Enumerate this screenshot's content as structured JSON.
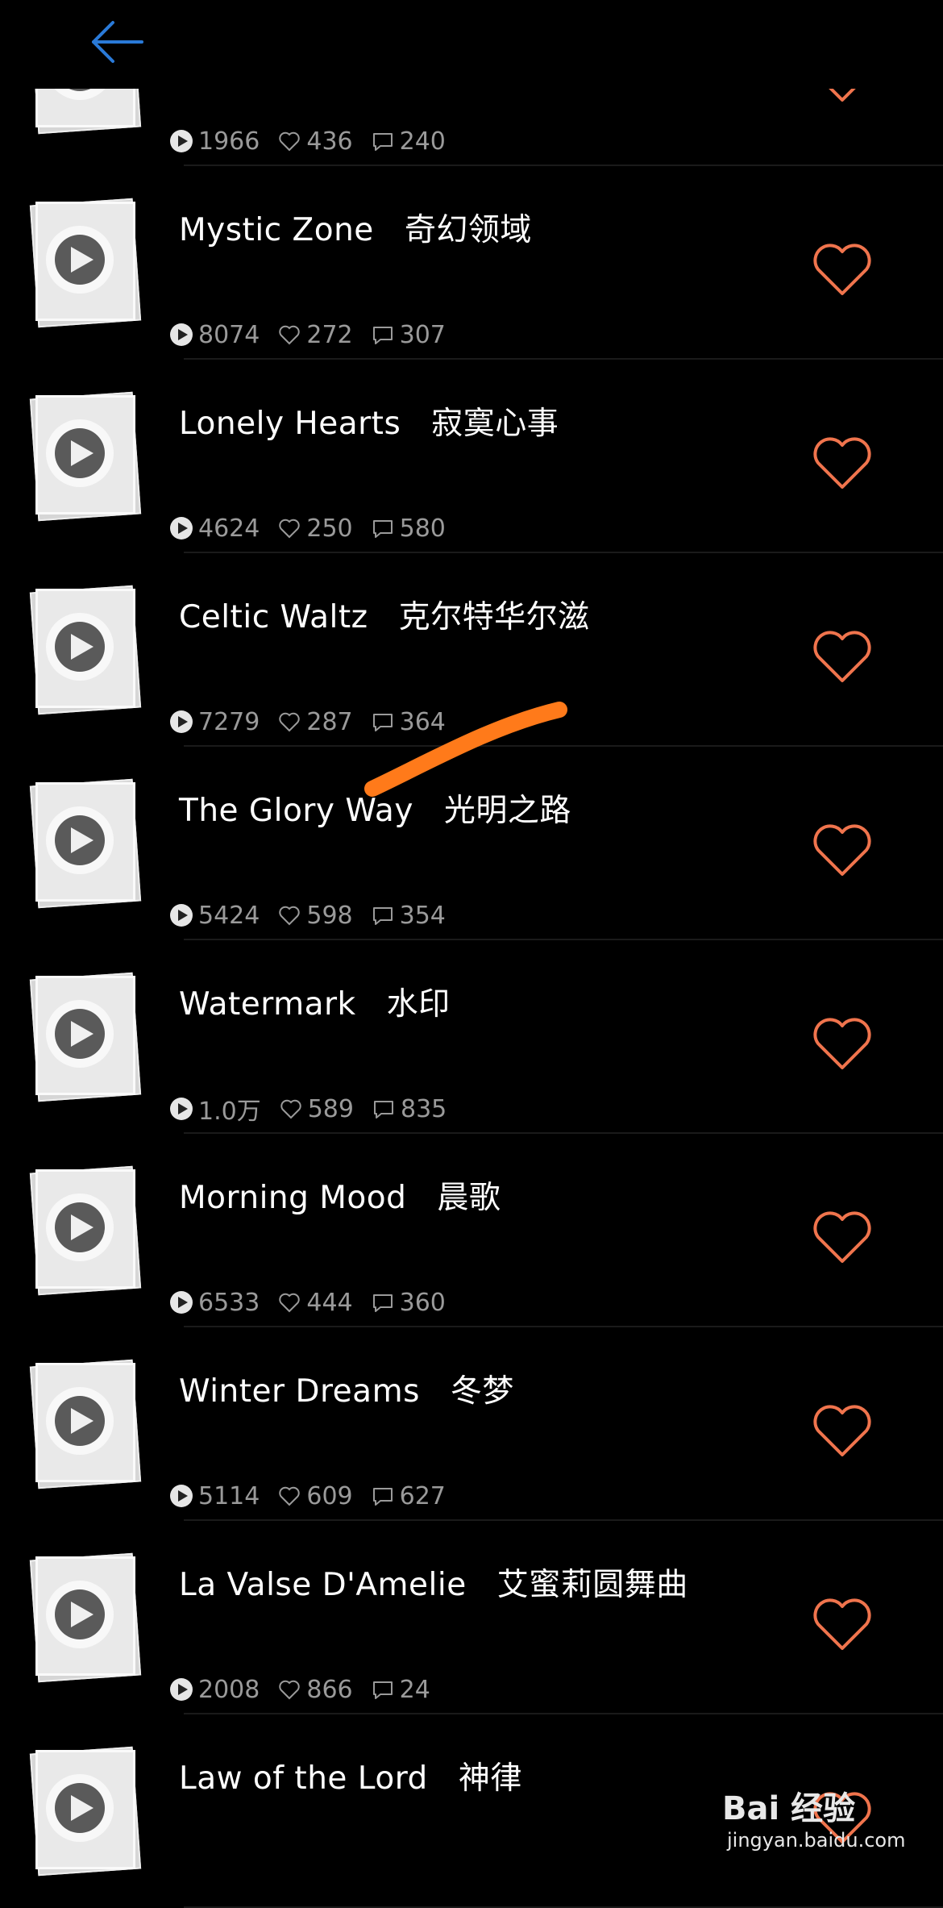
{
  "header": {
    "back_icon": "arrow-left-icon",
    "accent": "#2a7ad8"
  },
  "colors": {
    "heart": "#f0744d",
    "stat": "#9a9a9a",
    "stroke": "#ff7a1a"
  },
  "tracks": [
    {
      "title_en": "",
      "title_zh": "",
      "plays": "1966",
      "likes": "436",
      "comments": "240"
    },
    {
      "title_en": "Mystic Zone",
      "title_zh": "奇幻领域",
      "plays": "8074",
      "likes": "272",
      "comments": "307"
    },
    {
      "title_en": "Lonely Hearts",
      "title_zh": "寂寞心事",
      "plays": "4624",
      "likes": "250",
      "comments": "580"
    },
    {
      "title_en": "Celtic Waltz",
      "title_zh": "克尔特华尔滋",
      "plays": "7279",
      "likes": "287",
      "comments": "364"
    },
    {
      "title_en": "The Glory Way",
      "title_zh": "光明之路",
      "plays": "5424",
      "likes": "598",
      "comments": "354"
    },
    {
      "title_en": "Watermark",
      "title_zh": "水印",
      "plays": "1.0万",
      "likes": "589",
      "comments": "835"
    },
    {
      "title_en": "Morning Mood",
      "title_zh": "晨歌",
      "plays": "6533",
      "likes": "444",
      "comments": "360"
    },
    {
      "title_en": "Winter Dreams",
      "title_zh": "冬梦",
      "plays": "5114",
      "likes": "609",
      "comments": "627"
    },
    {
      "title_en": "La Valse D'Amelie",
      "title_zh": "艾蜜莉圆舞曲",
      "plays": "2008",
      "likes": "866",
      "comments": "24"
    },
    {
      "title_en": "Law of the Lord",
      "title_zh": "神律",
      "plays": "",
      "likes": "",
      "comments": ""
    }
  ],
  "watermark": {
    "brand": "Bai  经验",
    "url": "jingyan.baidu.com"
  }
}
